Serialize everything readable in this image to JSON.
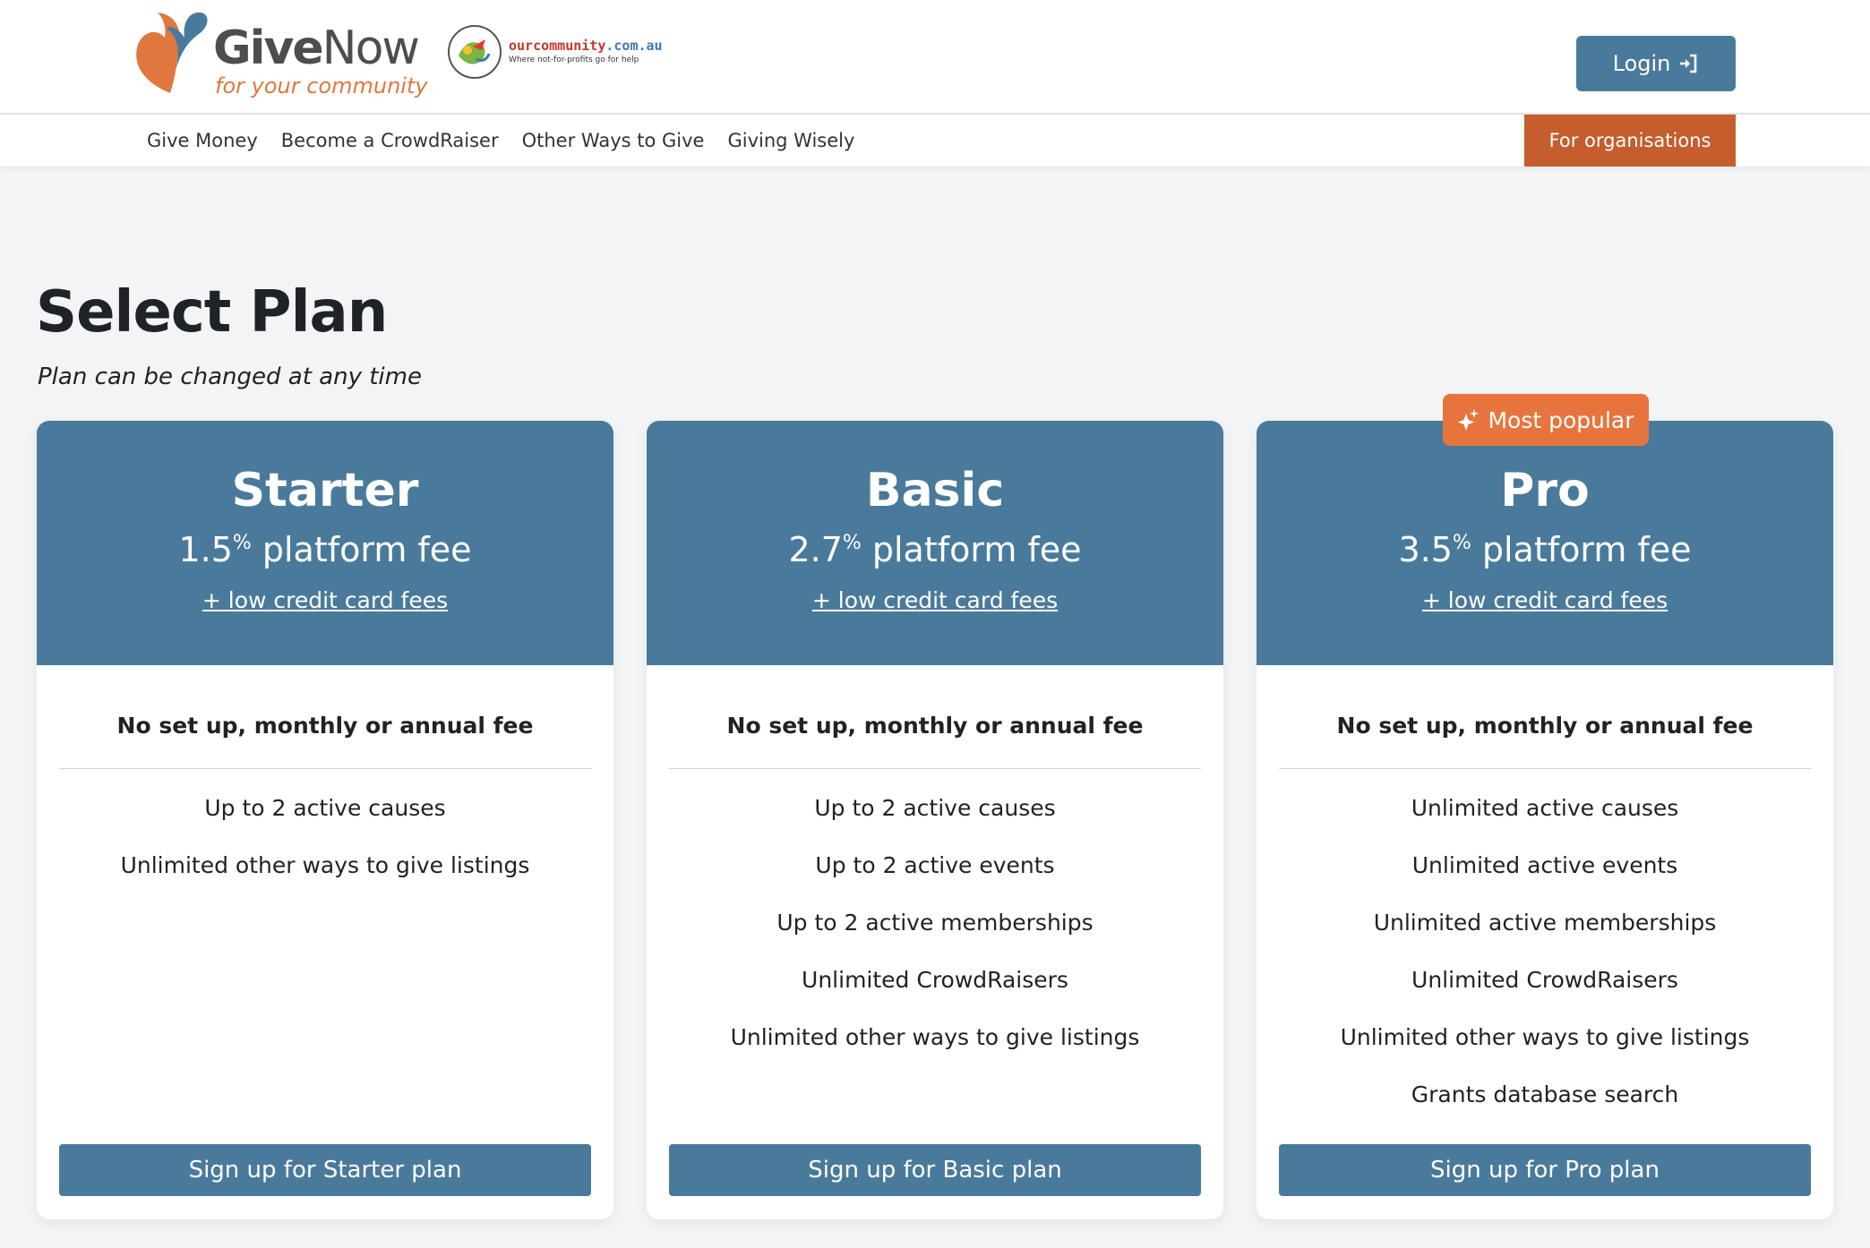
{
  "header": {
    "logo": {
      "brand_bold": "Give",
      "brand_light": "Now",
      "tagline": "for your community"
    },
    "partner_logo": {
      "name_prefix": "ourcommunity",
      "name_domain": ".com.au",
      "slogan": "Where not-for-profits go for help"
    },
    "login_label": "Login",
    "nav": [
      "Give Money",
      "Become a CrowdRaiser",
      "Other Ways to Give",
      "Giving Wisely"
    ],
    "org_button": "For organisations"
  },
  "page": {
    "title": "Select Plan",
    "subtitle": "Plan can be changed at any time",
    "badge": "Most popular"
  },
  "plans": [
    {
      "name": "Starter",
      "fee_value": "1.5",
      "fee_unit": "%",
      "fee_text": "platform fee",
      "cc_link": "+ low credit card fees",
      "no_fee": "No set up, monthly or annual fee",
      "features": [
        "Up to 2 active causes",
        "Unlimited other ways to give listings"
      ],
      "signup": "Sign up for Starter plan"
    },
    {
      "name": "Basic",
      "fee_value": "2.7",
      "fee_unit": "%",
      "fee_text": "platform fee",
      "cc_link": "+ low credit card fees",
      "no_fee": "No set up, monthly or annual fee",
      "features": [
        "Up to 2 active causes",
        "Up to 2 active events",
        "Up to 2 active memberships",
        "Unlimited CrowdRaisers",
        "Unlimited other ways to give listings"
      ],
      "signup": "Sign up for Basic plan"
    },
    {
      "name": "Pro",
      "fee_value": "3.5",
      "fee_unit": "%",
      "fee_text": "platform fee",
      "cc_link": "+ low credit card fees",
      "no_fee": "No set up, monthly or annual fee",
      "features": [
        "Unlimited active causes",
        "Unlimited active events",
        "Unlimited active memberships",
        "Unlimited CrowdRaisers",
        "Unlimited other ways to give listings",
        "Grants database search"
      ],
      "signup": "Sign up for Pro plan"
    }
  ],
  "colors": {
    "primary": "#4a7a9b",
    "org_button": "#c55d2c",
    "badge": "#e8743d",
    "background": "#f3f4f6"
  }
}
